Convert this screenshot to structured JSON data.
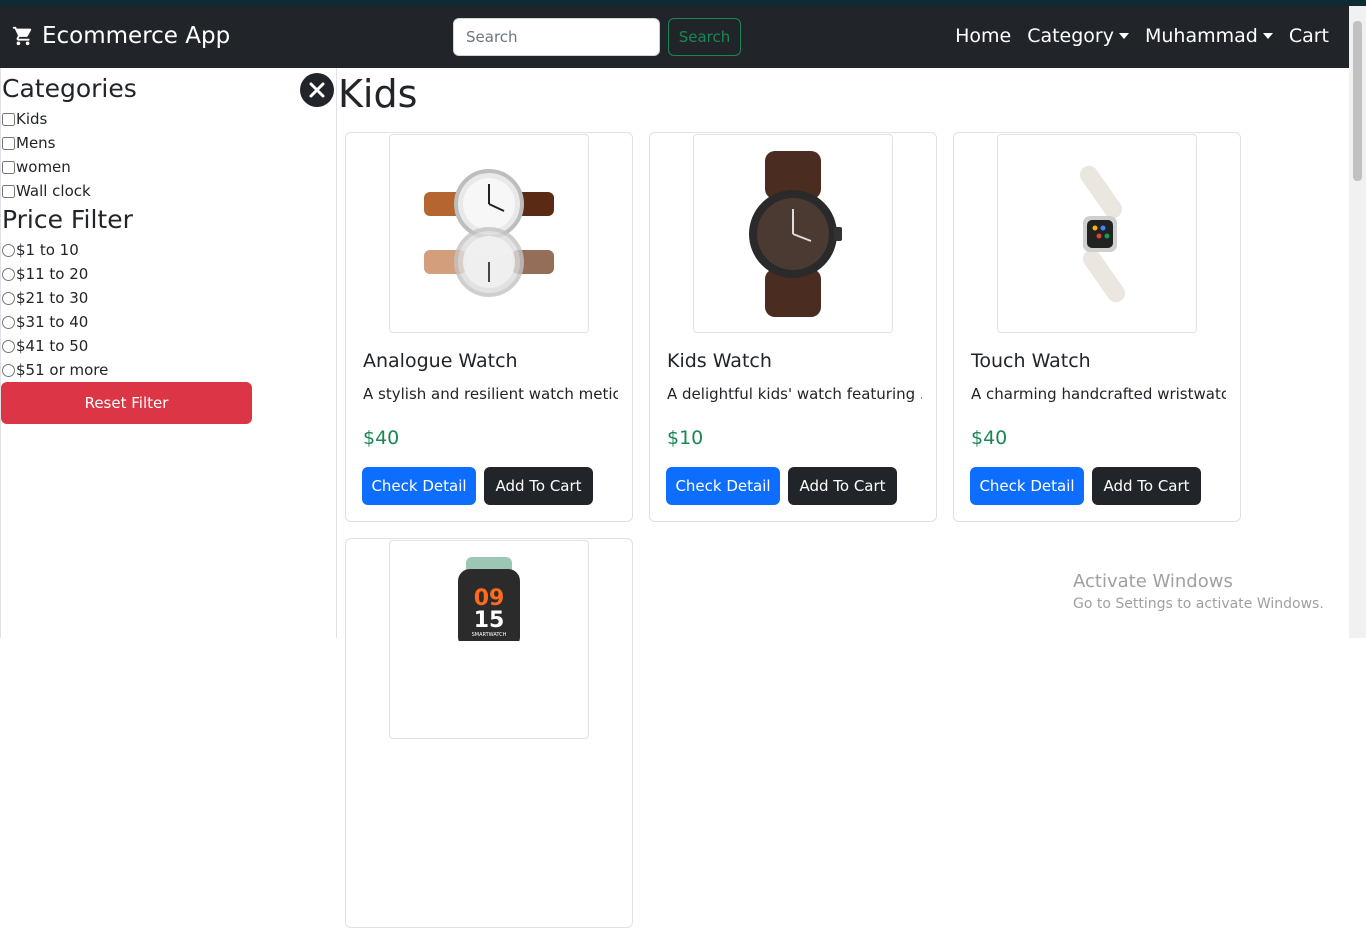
{
  "navbar": {
    "brand": "Ecommerce App",
    "search_placeholder": "Search",
    "search_value": "",
    "search_button": "Search",
    "links": [
      "Home",
      "Category",
      "Muhammad",
      "Cart"
    ]
  },
  "sidebar": {
    "categories_title": "Categories",
    "categories": [
      "Kids",
      "Mens",
      "women",
      "Wall clock"
    ],
    "price_title": "Price Filter",
    "prices": [
      "$1 to 10",
      "$11 to 20",
      "$21 to 30",
      "$31 to 40",
      "$41 to 50",
      "$51 or more"
    ],
    "reset_button": "Reset Filter"
  },
  "main": {
    "title": "Kids",
    "products": [
      {
        "name": "Analogue Watch",
        "desc": "A stylish and resilient watch metic...",
        "price": "$40",
        "detail_button": "Check Detail",
        "cart_button": "Add To Cart"
      },
      {
        "name": "Kids Watch",
        "desc": "A delightful kids' watch featuring ...",
        "price": "$10",
        "detail_button": "Check Detail",
        "cart_button": "Add To Cart"
      },
      {
        "name": "Touch Watch",
        "desc": "A charming handcrafted wristwatc...",
        "price": "$40",
        "detail_button": "Check Detail",
        "cart_button": "Add To Cart"
      },
      {
        "smartwatch_time_top": "09",
        "smartwatch_time_bottom": "15",
        "smartwatch_label": "SMARTWATCH"
      }
    ]
  },
  "watermark": {
    "line1": "Activate Windows",
    "line2": "Go to Settings to activate Windows."
  }
}
